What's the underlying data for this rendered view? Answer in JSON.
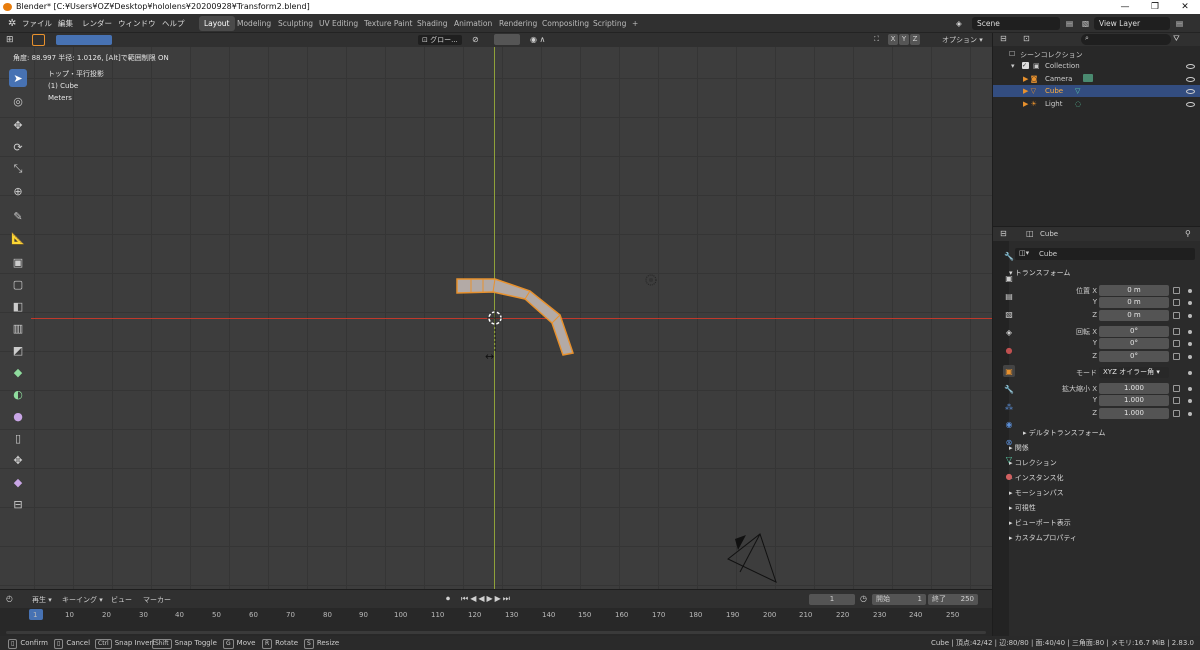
{
  "window": {
    "title": "Blender* [C:¥Users¥OZ¥Desktop¥hololens¥20200928¥Transform2.blend]",
    "min": "—",
    "max": "❐",
    "close": "✕"
  },
  "menu": [
    "ファイル",
    "編集",
    "レンダー",
    "ウィンドウ",
    "ヘルプ"
  ],
  "workspaces": [
    "Layout",
    "Modeling",
    "Sculpting",
    "UV Editing",
    "Texture Paint",
    "Shading",
    "Animation",
    "Rendering",
    "Compositing",
    "Scripting",
    "+"
  ],
  "scene": "Scene",
  "view_layer": "View Layer",
  "viewport": {
    "header": {
      "transform_orientation": "グロー...",
      "axes": [
        "X",
        "Y",
        "Z"
      ],
      "options": "オプション"
    },
    "status": "角度: 88.997 半径: 1.0126, [Alt]で範囲制限 ON",
    "info_line1": "トップ・平行投影",
    "info_line2": "(1) Cube",
    "info_line3": "Meters"
  },
  "outliner": {
    "title": "シーンコレクション",
    "items": [
      {
        "label": "Collection"
      },
      {
        "label": "Camera"
      },
      {
        "label": "Cube"
      },
      {
        "label": "Light"
      }
    ]
  },
  "properties": {
    "header_object": "Cube",
    "object_name": "Cube",
    "transform_title": "トランスフォーム",
    "location_label": "位置 X",
    "rotation_label": "回転 X",
    "scale_label": "拡大縮小 X",
    "mode_label": "モード",
    "axis_y": "Y",
    "axis_z": "Z",
    "location": [
      "0 m",
      "0 m",
      "0 m"
    ],
    "rotation": [
      "0°",
      "0°",
      "0°"
    ],
    "mode": "XYZ オイラー角",
    "scale": [
      "1.000",
      "1.000",
      "1.000"
    ],
    "delta": "デルタトランスフォーム",
    "panels": [
      "関係",
      "コレクション",
      "インスタンス化",
      "モーションパス",
      "可視性",
      "ビューポート表示",
      "カスタムプロパティ"
    ]
  },
  "timeline": {
    "menus": [
      "再生",
      "キーイング",
      "ビュー",
      "マーカー"
    ],
    "current_frame": "1",
    "start_label": "開始",
    "start": "1",
    "end_label": "終了",
    "end": "250",
    "ticks": [
      "1",
      "10",
      "20",
      "30",
      "40",
      "50",
      "60",
      "70",
      "80",
      "90",
      "100",
      "110",
      "120",
      "130",
      "140",
      "150",
      "160",
      "170",
      "180",
      "190",
      "200",
      "210",
      "220",
      "230",
      "240",
      "250"
    ]
  },
  "statusbar": {
    "confirm": "Confirm",
    "cancel": "Cancel",
    "snap_invert": "Snap Invert",
    "snap_toggle": "Snap Toggle",
    "move": "Move",
    "rotate": "Rotate",
    "resize": "Resize",
    "key_cancel": "Esc",
    "key_snap_invert": "Ctrl",
    "key_snap_toggle": "Shift",
    "key_move": "G",
    "key_rotate": "R",
    "key_resize": "S",
    "stats": "Cube | 頂点:42/42 | 辺:80/80 | 面:40/40 | 三角面:80 | メモリ:16.7 MiB | 2.83.0"
  },
  "colors": {
    "accent": "#4772b3",
    "selection": "#e8912d",
    "x_axis": "#c0392b",
    "y_axis": "#8fa13a"
  }
}
